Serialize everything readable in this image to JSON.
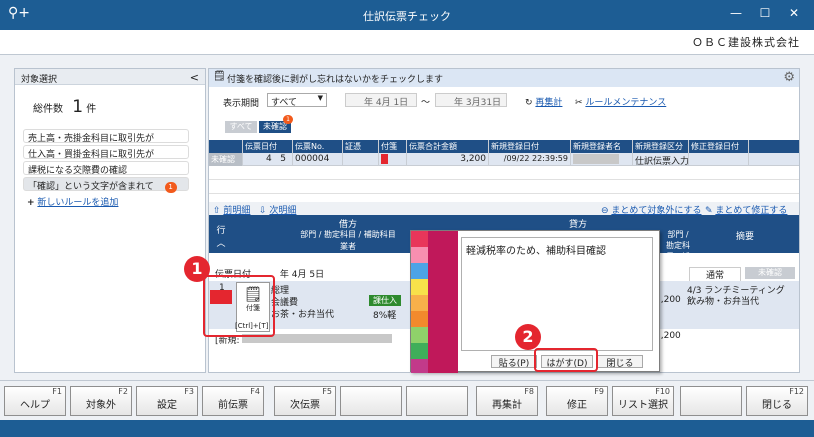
{
  "window": {
    "title": "仕訳伝票チェック",
    "company": "ＯＢＣ建設株式会社"
  },
  "left": {
    "header": "対象選択",
    "total_label": "総件数",
    "total_count": "1",
    "total_unit": "件",
    "rules": [
      "売上高・売掛金科目に取引先が",
      "仕入高・買掛金科目に取引先が",
      "課税になる交際費の確認",
      "「確認」という文字が含まれて"
    ],
    "rule_badge": "1",
    "add_rule": "新しいルールを追加"
  },
  "notice": "付箋を確認後に剥がし忘れはないかをチェックします",
  "filter": {
    "period_label": "表示期間",
    "period_value": "すべて",
    "from_date": "年  4月  1日",
    "tilde": "～",
    "to_date": "年  3月31日",
    "recalc": "再集計",
    "rule_maint": "ルールメンテナンス"
  },
  "tabs": {
    "all": "すべて",
    "unconfirmed": "未確認",
    "badge": "1"
  },
  "grid": {
    "headers": [
      "",
      "伝票日付",
      "伝票No.",
      "証憑",
      "付箋",
      "伝票合計金額",
      "新規登録日付",
      "新規登録者名",
      "新規登録区分",
      "修正登録日付"
    ],
    "row": {
      "status": "未確認",
      "date_m": "4",
      "date_d": "5",
      "no": "000004",
      "amount": "3,200",
      "reg_date": "/09/22 22:39:59",
      "reg_kind": "仕訳伝票入力"
    }
  },
  "detail_nav": {
    "prev": "前明細",
    "next": "次明細",
    "exclude_all": "まとめて対象外にする",
    "fix_all": "まとめて修正する"
  },
  "detail": {
    "col_row": "行",
    "debit": "借方",
    "credit": "貸方",
    "sub_debit": "部門 / 勘定科目 / 補助科目",
    "sub_credit": "部門 / 勘定科目 / 補助科目",
    "vendor": "業者",
    "summary": "摘要",
    "date_label": "伝票日付",
    "date_value": "年  4月  5日",
    "mode": "通常",
    "unconfirmed": "未確認",
    "row_no": "1",
    "dept": "総理",
    "account": "会議費",
    "sub": "お茶・お弁当代",
    "tax_badge": "課仕入",
    "tax_rate": "8%軽",
    "amount1": "3,200",
    "amount2": "3,200",
    "memo1": "4/3 ランチミーティング",
    "memo2": "飲み物・お弁当代",
    "new_label": "[新規:"
  },
  "fusen_tool": {
    "label": "付箋",
    "shortcut": "[Ctrl]+[T]"
  },
  "popup": {
    "text": "軽減税率のため、補助科目確認",
    "paste": "貼る(P)",
    "peel": "はがす(D)",
    "close": "閉じる"
  },
  "callouts": {
    "c1": "1",
    "c2": "2"
  },
  "fkeys": [
    {
      "key": "F1",
      "label": "ヘルプ"
    },
    {
      "key": "F2",
      "label": "対象外"
    },
    {
      "key": "F3",
      "label": "設定"
    },
    {
      "key": "F4",
      "label": "前伝票"
    },
    {
      "key": "F5",
      "label": "次伝票"
    },
    {
      "key": "",
      "label": ""
    },
    {
      "key": "",
      "label": ""
    },
    {
      "key": "F8",
      "label": "再集計"
    },
    {
      "key": "F9",
      "label": "修正"
    },
    {
      "key": "F10",
      "label": "リスト選択"
    },
    {
      "key": "",
      "label": ""
    },
    {
      "key": "F12",
      "label": "閉じる"
    }
  ],
  "colors": {
    "titlebar": "#1d5d94",
    "grid_header": "#1f4f86",
    "accent_red": "#e4262f",
    "badge_orange": "#f25a1c"
  },
  "swatch_colors": [
    "#e8365a",
    "#f78fb0",
    "#4da3e6",
    "#f7e14a",
    "#f7b04a",
    "#f28a2c",
    "#8fd16a",
    "#3fae5a",
    "#c23a8a"
  ]
}
